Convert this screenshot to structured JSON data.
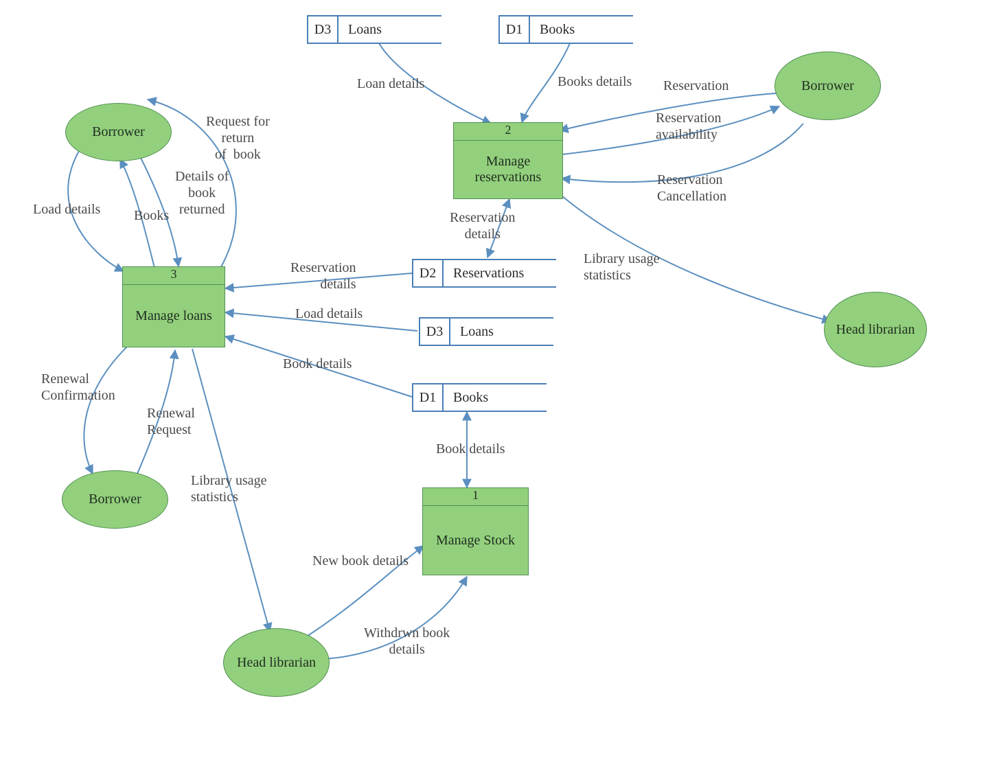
{
  "entities": {
    "borrower_top_left": "Borrower",
    "borrower_bottom_left": "Borrower",
    "borrower_top_right": "Borrower",
    "head_librarian_right": "Head librarian",
    "head_librarian_bottom": "Head librarian"
  },
  "processes": {
    "p1": {
      "number": "1",
      "name": "Manage Stock"
    },
    "p2": {
      "number": "2",
      "name": "Manage reservations"
    },
    "p3": {
      "number": "3",
      "name": "Manage loans"
    }
  },
  "stores": {
    "d3_top": {
      "id": "D3",
      "name": "Loans"
    },
    "d1_top": {
      "id": "D1",
      "name": "Books"
    },
    "d2_mid": {
      "id": "D2",
      "name": "Reservations"
    },
    "d3_mid": {
      "id": "D3",
      "name": "Loans"
    },
    "d1_mid": {
      "id": "D1",
      "name": "Books"
    }
  },
  "labels": {
    "load_details_left": "Load details",
    "books": "Books",
    "details_of_book_returned": "Details of\nbook\nreturned",
    "request_for_return": "Request for\nreturn\nof  book",
    "renewal_confirmation": "Renewal\nConfirmation",
    "renewal_request": "Renewal\nRequest",
    "library_usage_stats_left": "Library usage\nstatistics",
    "loan_details_top": "Loan details",
    "books_details_top": "Books details",
    "reservation_top": "Reservation",
    "reservation_availability": "Reservation\navailability",
    "reservation_cancellation": "Reservation\nCancellation",
    "reservation_details_vert": "Reservation\ndetails",
    "library_usage_stats_right": "Library usage\nstatistics",
    "reservation_details_mid": "Reservation\ndetails",
    "load_details_mid": "Load details",
    "book_details_mid": "Book details",
    "book_details_vert": "Book details",
    "new_book_details": "New book details",
    "withdrawn_book_details": "Withdrwn book\ndetails"
  }
}
